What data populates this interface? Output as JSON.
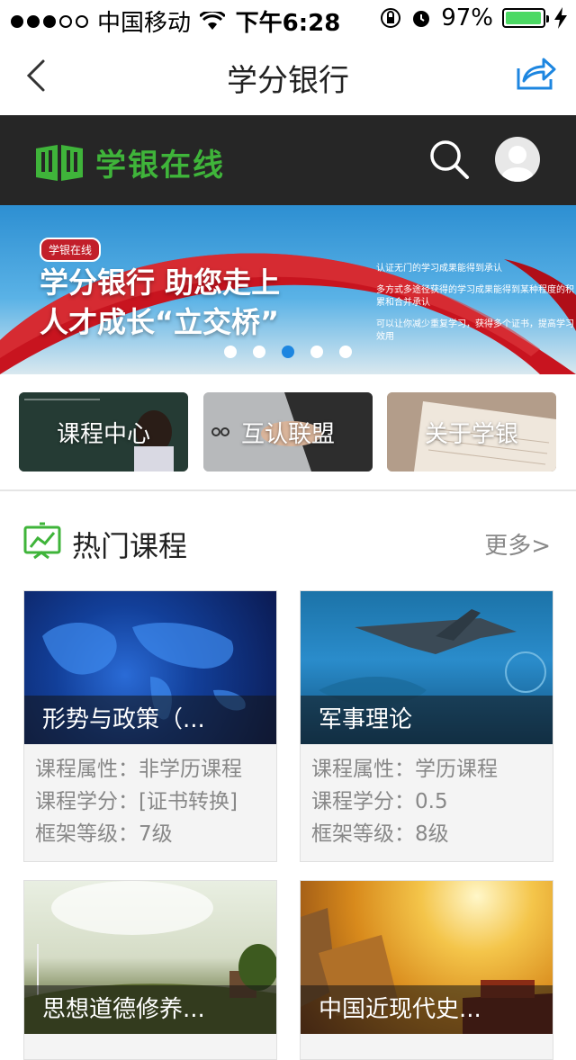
{
  "status_bar": {
    "carrier": "中国移动",
    "time": "下午6:28",
    "battery": "97%",
    "battery_level": 0.97
  },
  "navbar": {
    "title": "学分银行",
    "back_icon": "chevron-left-icon",
    "share_icon": "share-icon"
  },
  "header": {
    "logo_text": "学银在线",
    "search_icon": "search-icon",
    "avatar_icon": "avatar"
  },
  "banner": {
    "tag": "学银在线",
    "headline_line1": "学分银行 助您走上",
    "headline_line2": "人才成长“立交桥”",
    "bullets": [
      "认证无门的学习成果能得到承认",
      "多方式多途径获得的学习成果能得到某种程度的积累和合并承认",
      "可以让你减少重复学习，获得多个证书，提高学习效用"
    ],
    "active_index": 2,
    "count": 5
  },
  "quick_links": [
    {
      "label": "课程中心"
    },
    {
      "label": "互认联盟"
    },
    {
      "label": "关于学银"
    }
  ],
  "section": {
    "title": "热门课程",
    "more": "更多>"
  },
  "courses": [
    {
      "title": "形势与政策（...",
      "attr_label": "课程属性：",
      "attr_value": "非学历课程",
      "credit_label": "课程学分：",
      "credit_value": "[证书转换]",
      "level_label": "框架等级：",
      "level_value": "7级"
    },
    {
      "title": "军事理论",
      "attr_label": "课程属性：",
      "attr_value": "学历课程",
      "credit_label": "课程学分：",
      "credit_value": "0.5",
      "level_label": "框架等级：",
      "level_value": "8级"
    },
    {
      "title": "思想道德修养..."
    },
    {
      "title": "中国近现代史..."
    }
  ],
  "colors": {
    "brand_green": "#3fb43a",
    "accent_blue": "#1d86e0",
    "header_dark": "#262626"
  }
}
